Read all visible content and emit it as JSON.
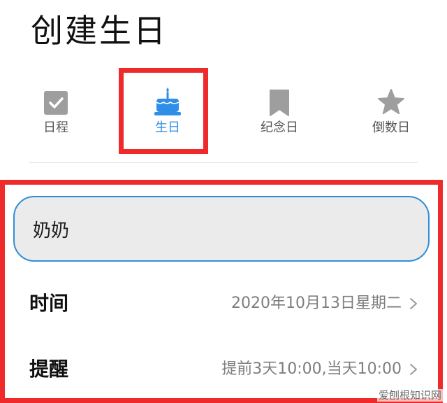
{
  "header": {
    "title": "创建生日"
  },
  "tabs": [
    {
      "id": "schedule",
      "label": "日程",
      "icon": "calendar-check-icon",
      "active": false
    },
    {
      "id": "birthday",
      "label": "生日",
      "icon": "birthday-cake-icon",
      "active": true
    },
    {
      "id": "anniversary",
      "label": "纪念日",
      "icon": "bookmark-icon",
      "active": false
    },
    {
      "id": "countdown",
      "label": "倒数日",
      "icon": "star-icon",
      "active": false
    }
  ],
  "form": {
    "name_value": "奶奶",
    "time": {
      "label": "时间",
      "value": "2020年10月13日星期二"
    },
    "reminder": {
      "label": "提醒",
      "value": "提前3天10:00,当天10:00"
    }
  },
  "watermark": "爱刨根知识网",
  "colors": {
    "accent": "#2f8fe8",
    "icon_gray": "#9e9e9e",
    "highlight_red": "#ef2a2a",
    "input_border": "#2e8fd8"
  }
}
